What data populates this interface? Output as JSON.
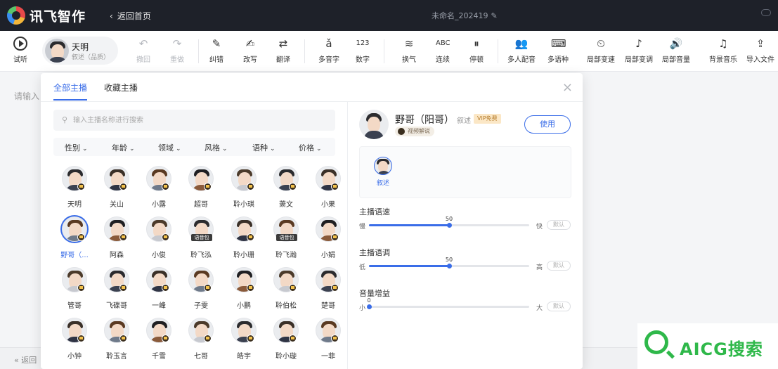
{
  "app": {
    "name": "讯飞智作",
    "back_label": "返回首页",
    "doc_title": "未命名_202419"
  },
  "toolbar": {
    "listen": "试听",
    "speaker": {
      "name": "天明",
      "style": "叙述（品质）"
    },
    "items": [
      "撤回",
      "重做",
      "纠错",
      "改写",
      "翻译",
      "多音字",
      "数字",
      "换气",
      "连续",
      "停顿",
      "多人配音",
      "多语种",
      "局部变速",
      "局部变调",
      "局部音量",
      "背景音乐",
      "导入文件"
    ],
    "icons": [
      "↶",
      "↷",
      "✎",
      "✍",
      "⇄",
      "ǎ",
      "123",
      "≋",
      "ABC",
      "⏸",
      "👥",
      "⌨",
      "⏲",
      "♪",
      "🔊",
      "♫",
      "⇪"
    ]
  },
  "editor": {
    "placeholder": "请输入",
    "bottom_back": "返回"
  },
  "modal": {
    "tabs": [
      "全部主播",
      "收藏主播"
    ],
    "search_placeholder": "输入主播名称进行搜索",
    "filters": [
      "性别",
      "年龄",
      "领域",
      "风格",
      "语种",
      "价格"
    ],
    "anchors": [
      {
        "name": "天明"
      },
      {
        "name": "关山"
      },
      {
        "name": "小露"
      },
      {
        "name": "超哥"
      },
      {
        "name": "聆小琪"
      },
      {
        "name": "萧文"
      },
      {
        "name": "小果"
      },
      {
        "name": "野哥（...",
        "selected": true
      },
      {
        "name": "阿森"
      },
      {
        "name": "小俊"
      },
      {
        "name": "聆飞泓",
        "badge": "语音包"
      },
      {
        "name": "聆小珊"
      },
      {
        "name": "聆飞瀚",
        "badge": "语音包"
      },
      {
        "name": "小娟"
      },
      {
        "name": "管哥"
      },
      {
        "name": "飞碟哥"
      },
      {
        "name": "一峰"
      },
      {
        "name": "子雯"
      },
      {
        "name": "小鹏"
      },
      {
        "name": "聆伯松"
      },
      {
        "name": "楚哥"
      },
      {
        "name": "小钟"
      },
      {
        "name": "聆玉言"
      },
      {
        "name": "千雪"
      },
      {
        "name": "七哥"
      },
      {
        "name": "皓宇"
      },
      {
        "name": "聆小璇"
      },
      {
        "name": "一菲"
      }
    ],
    "detail": {
      "name": "野哥（阳哥）",
      "style": "叙述",
      "vip": "VIP免费",
      "scene": "视频解说",
      "use_label": "使用",
      "styles": [
        "叙述"
      ]
    },
    "sliders": [
      {
        "title": "主播语速",
        "left": "慢",
        "right": "快",
        "value": 50,
        "fraction": 0.5,
        "reset": "默认"
      },
      {
        "title": "主播语调",
        "left": "低",
        "right": "高",
        "value": 50,
        "fraction": 0.5,
        "reset": "默认"
      },
      {
        "title": "音量增益",
        "left": "小",
        "right": "大",
        "value": 0,
        "fraction": 0.0,
        "reset": "默认"
      }
    ]
  },
  "watermark": {
    "text": "AICG搜索"
  },
  "colors": {
    "accent": "#3a6de8",
    "topbar": "#1e2129",
    "watermark": "#2fb84a",
    "vip": "#fbe7c6"
  }
}
